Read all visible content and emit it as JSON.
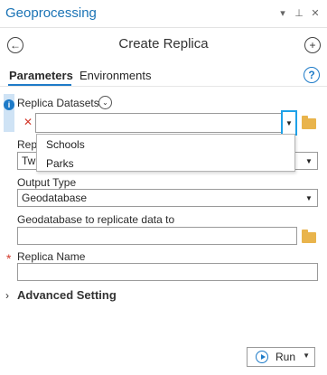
{
  "pane": {
    "title": "Geoprocessing",
    "title_icons": [
      "pin-icon",
      "pin-icon",
      "close-icon"
    ]
  },
  "tool": {
    "title": "Create Replica"
  },
  "tabs": [
    {
      "label": "Parameters",
      "active": true
    },
    {
      "label": "Environments",
      "active": false
    }
  ],
  "params": {
    "replica_datasets_label": "Replica Datasets",
    "replica_datasets_value": "",
    "replica_datasets_options": [
      "Schools",
      "Parks"
    ],
    "replica_type_label": "Rep",
    "replica_type_value": "Tw",
    "output_type_label": "Output Type",
    "output_type_value": "Geodatabase",
    "geodatabase_label": "Geodatabase to replicate data to",
    "geodatabase_value": "",
    "replica_name_label": "Replica Name",
    "replica_name_value": "",
    "required_marker": "*"
  },
  "advanced": {
    "label": "Advanced Setting"
  },
  "run": {
    "label": "Run"
  },
  "colors": {
    "accent": "#1e7bc8",
    "title": "#1a73b5",
    "required": "#d33a2c",
    "folder": "#e9b44c"
  }
}
